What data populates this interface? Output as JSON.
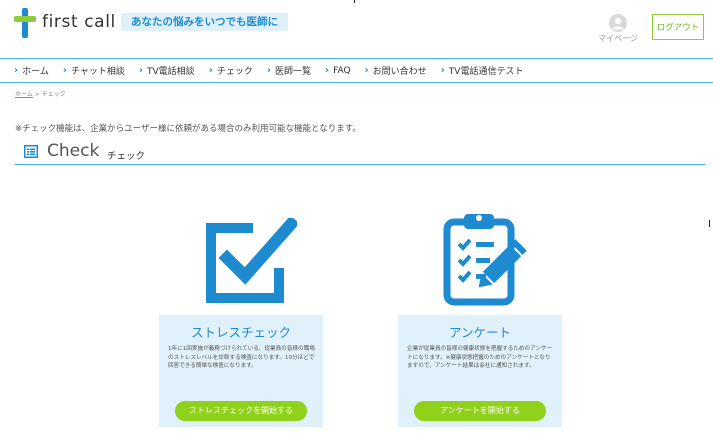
{
  "header": {
    "brand": "first call",
    "tagline": "あなたの悩みをいつでも医師に",
    "mypage_label": "マイページ",
    "logout_label": "ログアウト"
  },
  "nav": {
    "items": [
      {
        "label": "ホーム"
      },
      {
        "label": "チャット相談"
      },
      {
        "label": "TV電話相談"
      },
      {
        "label": "チェック"
      },
      {
        "label": "医師一覧"
      },
      {
        "label": "FAQ"
      },
      {
        "label": "お問い合わせ"
      },
      {
        "label": "TV電話通信テスト"
      }
    ]
  },
  "breadcrumb": {
    "home": "ホーム",
    "separator": ">",
    "current": "チェック"
  },
  "notice": "※チェック機能は、企業からユーザー様に依頼がある場合のみ利用可能な機能となります。",
  "section": {
    "title_en": "Check",
    "title_ja": "チェック"
  },
  "cards": [
    {
      "title": "ストレスチェック",
      "desc": "1年に1回実施が義務づけられている、従業員の皆様の職場のストレスレベルを診断する検査になります。10分ほどで回答できる簡単な検査になります。",
      "button": "ストレスチェックを開始する",
      "icon": "checkbox-icon"
    },
    {
      "title": "アンケート",
      "desc": "企業が従業員の皆様の健康状態を把握するためのアンケートになります。※健康状態把握のためのアンケートとなりますので、アンケート結果は会社に通知されます。",
      "button": "アンケートを開始する",
      "icon": "clipboard-icon"
    }
  ],
  "colors": {
    "accent_blue": "#1e8ad0",
    "nav_line": "#45b4e0",
    "logo_green": "#8ecc3a",
    "button_green": "#8fd11b",
    "card_bg": "#e0f1fb"
  }
}
